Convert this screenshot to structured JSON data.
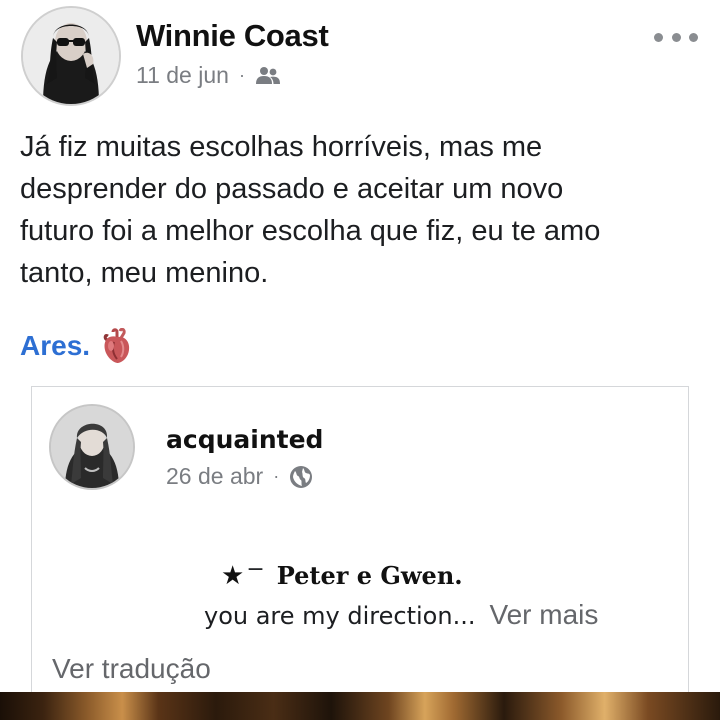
{
  "post": {
    "author": "Winnie Coast",
    "date": "11 de jun",
    "separator": "·",
    "audience_icon": "friends-icon",
    "menu_icon": "more-horizontal-icon",
    "text_lines": [
      "Já fiz muitas escolhas horríveis, mas me",
      "desprender do passado e aceitar um novo",
      "futuro foi a melhor escolha que fiz, eu te amo",
      "tanto, meu menino."
    ],
    "mention": "Ares.",
    "mention_emoji_icon": "anatomical-heart-icon"
  },
  "shared_post": {
    "author": "acquainted",
    "date": "26 de abr",
    "separator": "·",
    "audience_icon": "globe-icon",
    "title_star": "★",
    "title_dash": "−",
    "title": "Peter e Gwen.",
    "preview": "you are my direction",
    "ellipsis": "...",
    "see_more": "Ver mais",
    "translate": "Ver tradução"
  },
  "colors": {
    "mention": "#2d6fd3",
    "secondary_text": "#65676b",
    "meta_text": "#7a7d82",
    "border": "#d5d7da"
  }
}
